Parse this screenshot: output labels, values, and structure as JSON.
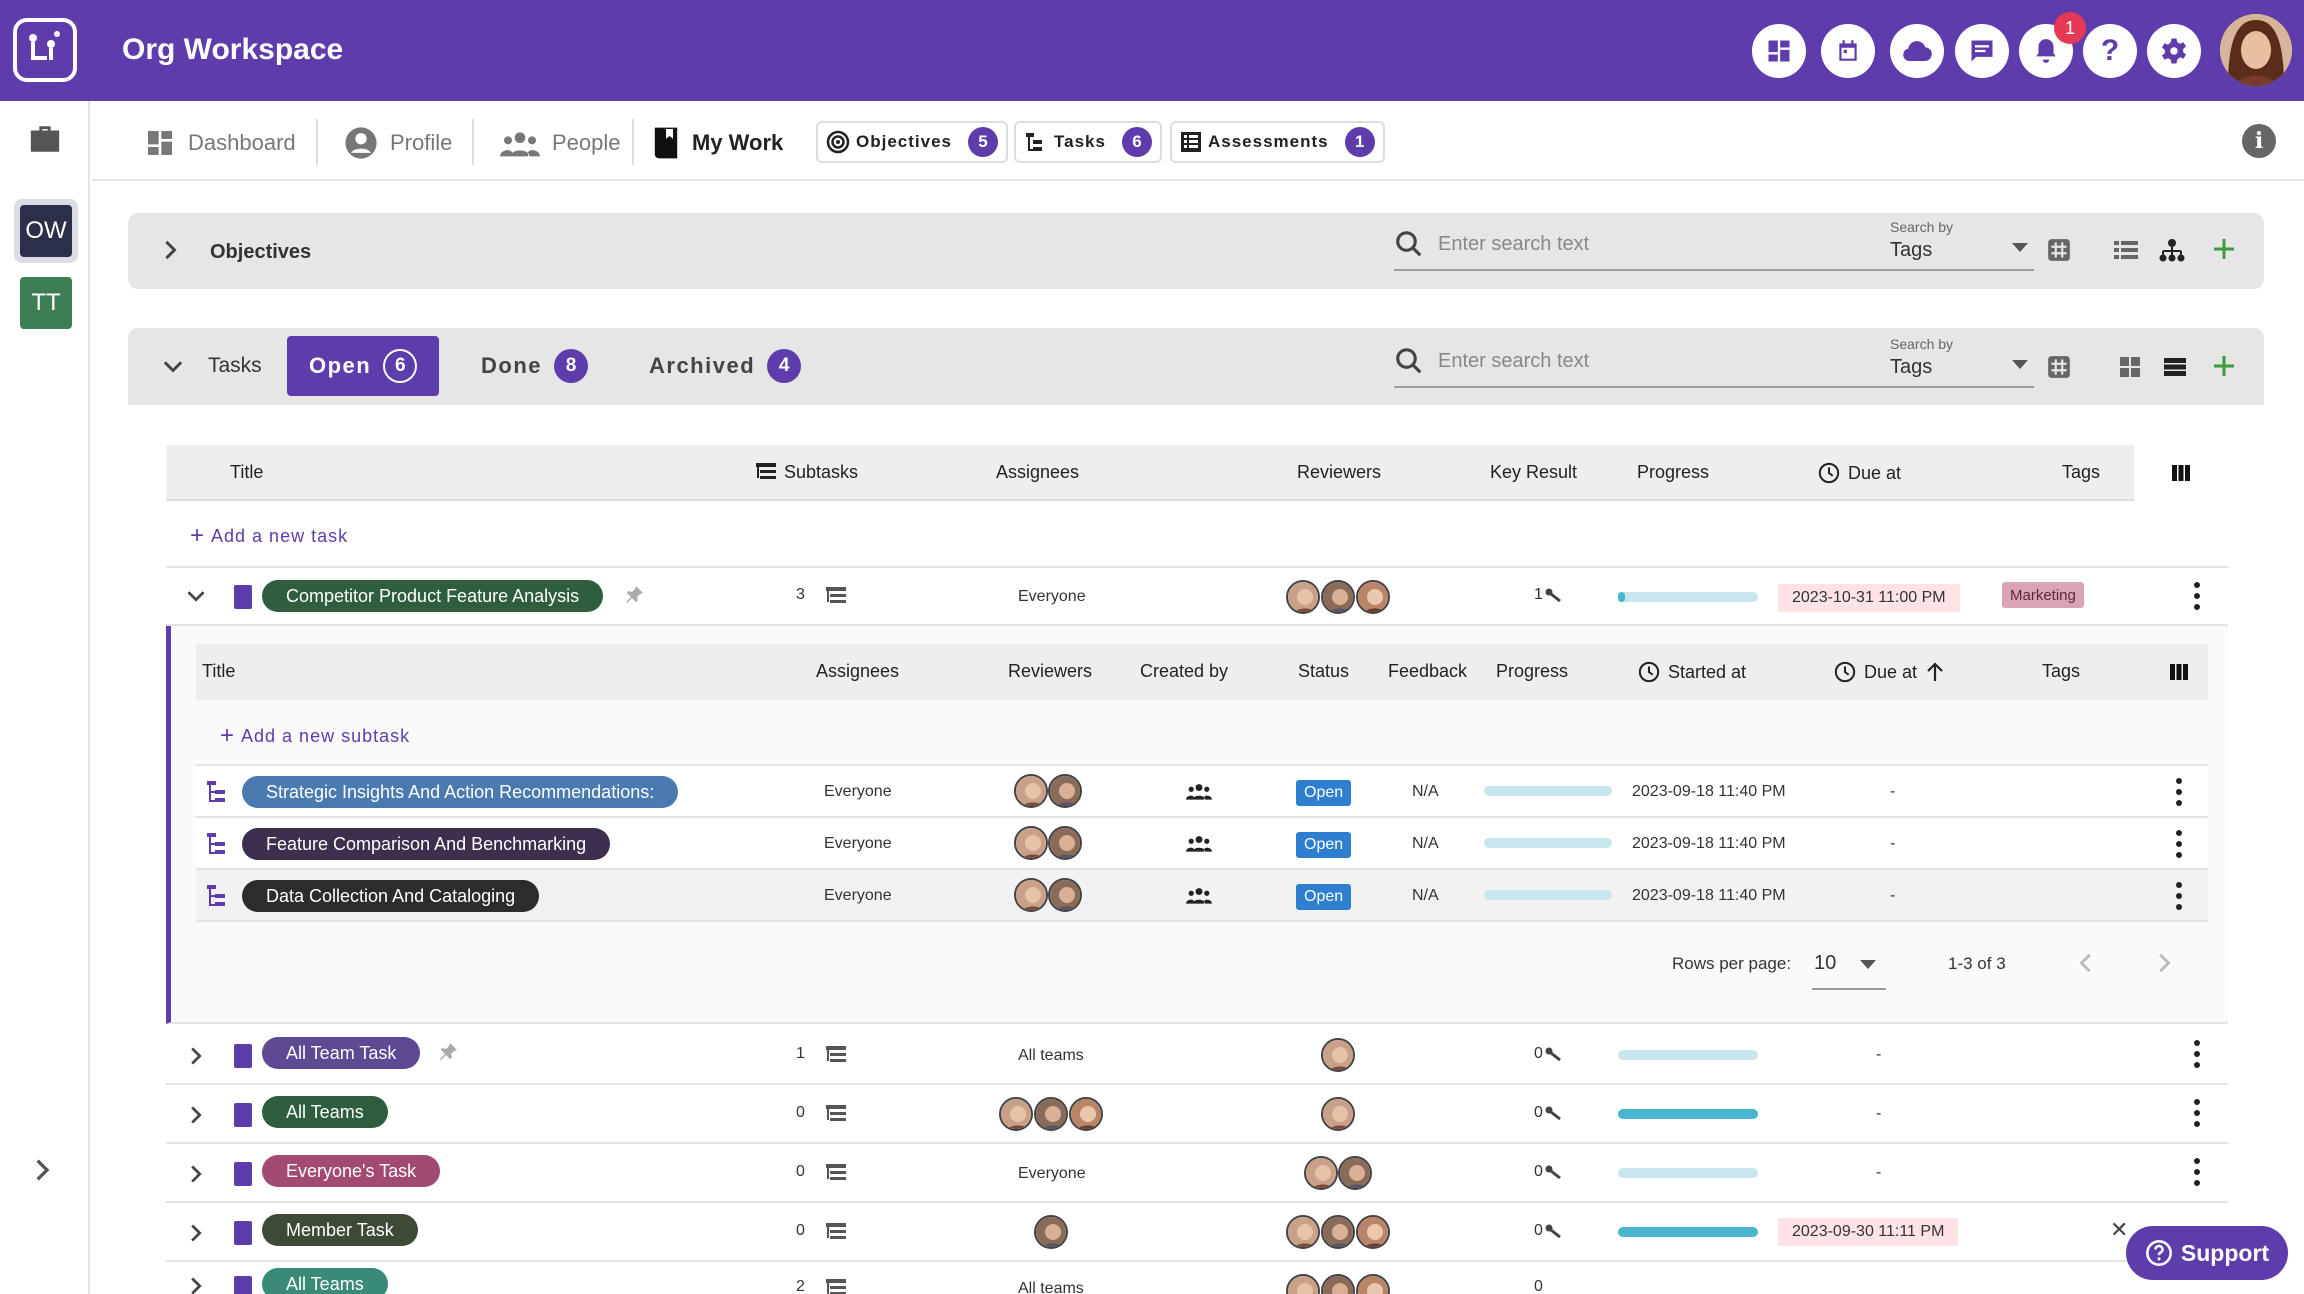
{
  "app": {
    "title": "Org Workspace",
    "notifications_count": "1"
  },
  "topbar_icons": [
    "dashboard-icon",
    "calendar-icon",
    "cloud-icon",
    "chat-icon",
    "bell-icon",
    "help-icon",
    "gear-icon"
  ],
  "rail": {
    "workspaces": [
      {
        "initials": "OW",
        "color": "#2b2f4a"
      },
      {
        "initials": "TT",
        "color": "#3e7e55"
      }
    ]
  },
  "subnav": {
    "dashboard": "Dashboard",
    "profile": "Profile",
    "people": "People",
    "my_work": "My Work",
    "chips": [
      {
        "label": "Objectives",
        "count": "5"
      },
      {
        "label": "Tasks",
        "count": "6"
      },
      {
        "label": "Assessments",
        "count": "1"
      }
    ]
  },
  "objectives_panel": {
    "title": "Objectives",
    "search_placeholder": "Enter search text",
    "search_by_label": "Search by",
    "search_by_value": "Tags"
  },
  "tasks_panel": {
    "title": "Tasks",
    "tabs": [
      {
        "label": "Open",
        "count": "6"
      },
      {
        "label": "Done",
        "count": "8"
      },
      {
        "label": "Archived",
        "count": "4"
      }
    ],
    "search_placeholder": "Enter search text",
    "search_by_label": "Search by",
    "search_by_value": "Tags"
  },
  "tasks_table": {
    "headers": {
      "title": "Title",
      "subtasks": "Subtasks",
      "assignees": "Assignees",
      "reviewers": "Reviewers",
      "key_result": "Key Result",
      "progress": "Progress",
      "due_at": "Due at",
      "tags": "Tags"
    },
    "add_task": "Add a new task",
    "rows": [
      {
        "title": "Competitor Product Feature Analysis",
        "color": "#2f5e3f",
        "subtasks": "3",
        "assignees": "Everyone",
        "key_result": "1",
        "progress": 0.05,
        "due_at": "2023-10-31 11:00 PM",
        "tag": "Marketing"
      },
      {
        "title": "All Team Task",
        "color": "#5e4a92",
        "subtasks": "1",
        "assignees": "All teams",
        "key_result": "0",
        "progress": 0,
        "due_at": "-",
        "tag": ""
      },
      {
        "title": "All Teams",
        "color": "#2f5e3f",
        "subtasks": "0",
        "assignees": "",
        "key_result": "0",
        "progress": 1,
        "due_at": "-",
        "tag": ""
      },
      {
        "title": "Everyone's Task",
        "color": "#a34a72",
        "subtasks": "0",
        "assignees": "Everyone",
        "key_result": "0",
        "progress": 0,
        "due_at": "-",
        "tag": ""
      },
      {
        "title": "Member Task",
        "color": "#3c4a36",
        "subtasks": "0",
        "assignees": "",
        "key_result": "0",
        "progress": 1,
        "due_at": "2023-09-30 11:11 PM",
        "tag": ""
      },
      {
        "title": "All Teams",
        "color": "#3a8a78",
        "subtasks": "2",
        "assignees": "All teams",
        "key_result": "0",
        "progress": 0,
        "due_at": "",
        "tag": ""
      }
    ]
  },
  "subtasks_table": {
    "headers": {
      "title": "Title",
      "assignees": "Assignees",
      "reviewers": "Reviewers",
      "created_by": "Created by",
      "status": "Status",
      "feedback": "Feedback",
      "progress": "Progress",
      "started_at": "Started at",
      "due_at": "Due at",
      "tags": "Tags"
    },
    "add_subtask": "Add a new subtask",
    "rows": [
      {
        "title": "Strategic Insights And Action Recommendations:",
        "color": "#4a7ab0",
        "assignees": "Everyone",
        "status": "Open",
        "feedback": "N/A",
        "progress": 0,
        "started_at": "2023-09-18 11:40 PM",
        "due_at": "-"
      },
      {
        "title": "Feature Comparison And Benchmarking",
        "color": "#3f2f4e",
        "assignees": "Everyone",
        "status": "Open",
        "feedback": "N/A",
        "progress": 0,
        "started_at": "2023-09-18 11:40 PM",
        "due_at": "-"
      },
      {
        "title": "Data Collection And Cataloging",
        "color": "#2c2c2c",
        "assignees": "Everyone",
        "status": "Open",
        "feedback": "N/A",
        "progress": 0,
        "started_at": "2023-09-18 11:40 PM",
        "due_at": "-"
      }
    ],
    "rows_per_page_label": "Rows per page:",
    "rows_per_page": "10",
    "range": "1-3 of 3"
  },
  "support": {
    "label": "Support"
  },
  "colors": {
    "brand": "#5e3cac",
    "progress": "#4ab5cf",
    "progress_track": "#c8e6ee",
    "date_due": "#fde3e3"
  }
}
